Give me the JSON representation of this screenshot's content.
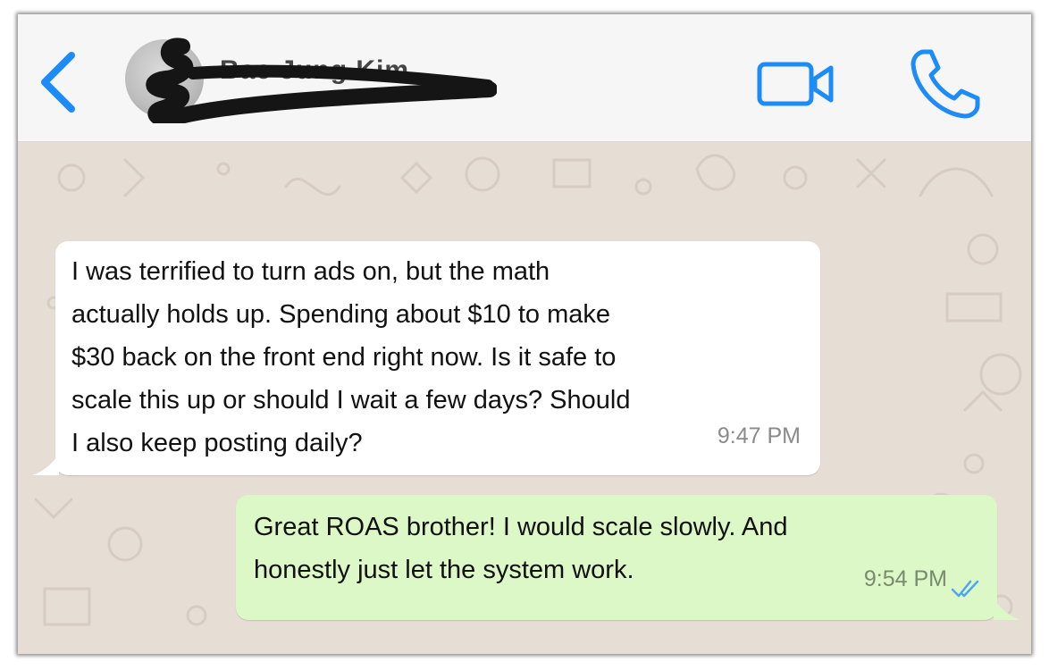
{
  "header": {
    "contact_name": "Bae Jung Kim",
    "back_icon": "chevron-left-icon",
    "video_icon": "video-camera-icon",
    "call_icon": "phone-icon",
    "accent_color": "#1d8cf8"
  },
  "messages": [
    {
      "direction": "incoming",
      "text": "I was terrified to turn ads on, but the math\nactually holds up. Spending about $10 to make\n$30 back on the front end right now. Is it safe to\nscale this up or should I wait a few days? Should\nI also keep posting daily?",
      "time": "9:47 PM",
      "bubble_color": "#ffffff"
    },
    {
      "direction": "outgoing",
      "text": "Great ROAS brother! I would scale slowly. And\nhonestly just let the system work.",
      "time": "9:54 PM",
      "status_icon": "double-check-icon",
      "status": "read",
      "bubble_color": "#dcf8c6"
    }
  ],
  "colors": {
    "wallpaper": "#e6ddd4",
    "header_bg": "#f6f6f6",
    "read_ticks": "#4fa6f0"
  }
}
